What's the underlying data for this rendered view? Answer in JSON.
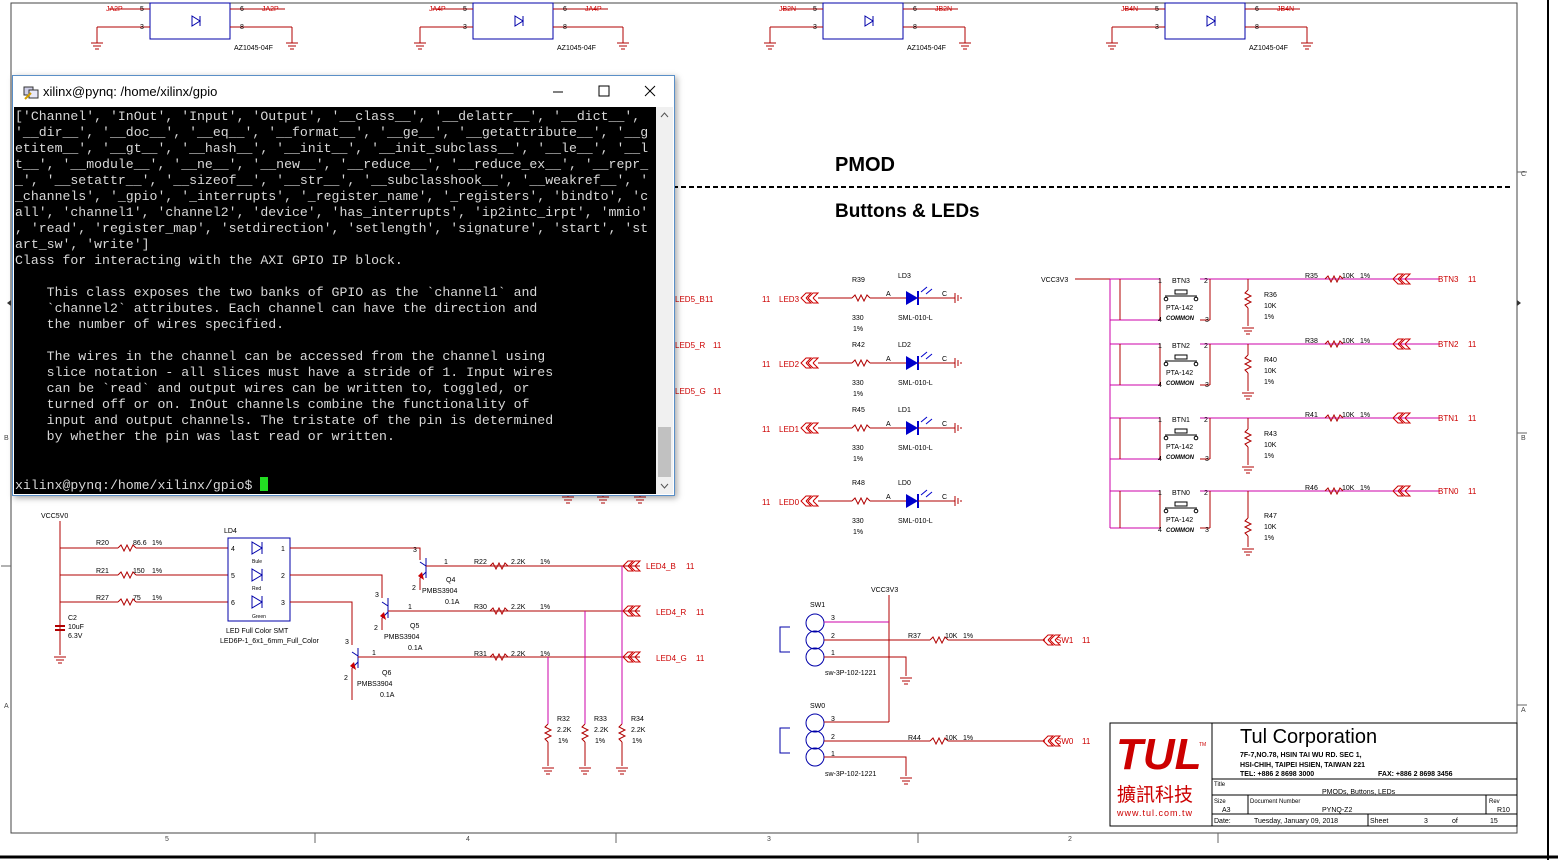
{
  "terminal": {
    "title": "xilinx@pynq: /home/xilinx/gpio",
    "lines": [
      "['Channel', 'InOut', 'Input', 'Output', '__class__', '__delattr__', '__dict__',",
      "'__dir__', '__doc__', '__eq__', '__format__', '__ge__', '__getattribute__', '__g",
      "etitem__', '__gt__', '__hash__', '__init__', '__init_subclass__', '__le__', '__l",
      "t__', '__module__', '__ne__', '__new__', '__reduce__', '__reduce_ex__', '__repr_",
      "_', '__setattr__', '__sizeof__', '__str__', '__subclasshook__', '__weakref__', '",
      "_channels', '_gpio', '_interrupts', '_register_name', '_registers', 'bindto', 'c",
      "all', 'channel1', 'channel2', 'device', 'has_interrupts', 'ip2intc_irpt', 'mmio'",
      ", 'read', 'register_map', 'setdirection', 'setlength', 'signature', 'start', 'st",
      "art_sw', 'write']",
      "Class for interacting with the AXI GPIO IP block.",
      "",
      "    This class exposes the two banks of GPIO as the `channel1` and",
      "    `channel2` attributes. Each channel can have the direction and",
      "    the number of wires specified.",
      "",
      "    The wires in the channel can be accessed from the channel using",
      "    slice notation - all slices must have a stride of 1. Input wires",
      "    can be `read` and output wires can be written to, toggled, or",
      "    turned off or on. InOut channels combine the functionality of",
      "    input and output channels. The tristate of the pin is determined",
      "    by whether the pin was last read or written.",
      "",
      ""
    ],
    "prompt": "xilinx@pynq:/home/xilinx/gpio$ "
  },
  "schematic": {
    "section_pmod": "PMOD",
    "section_buttons": "Buttons & LEDs",
    "top_parts": [
      {
        "net_left": "JA2P",
        "net_right": "JA2P",
        "part": "AZ1045-04F"
      },
      {
        "net_left": "JA4P",
        "net_right": "JA4P",
        "part": "AZ1045-04F"
      },
      {
        "net_left": "JB2N",
        "net_right": "JB2N",
        "part": "AZ1045-04F"
      },
      {
        "net_left": "JB4N",
        "net_right": "JB4N",
        "part": "AZ1045-04F"
      }
    ],
    "pin_labels": {
      "p5": "5",
      "p6": "6",
      "p3": "3",
      "p8": "8"
    },
    "led5_nets": [
      {
        "net": "LED5_B",
        "sheet": "11"
      },
      {
        "net": "LED5_R",
        "sheet": "11"
      },
      {
        "net": "LED5_G",
        "sheet": "11"
      }
    ],
    "leds": [
      {
        "sheet": "11",
        "net": "LED3",
        "res": "R39",
        "val": "330",
        "tol": "1%",
        "ref": "LD3",
        "part": "SML-010-L"
      },
      {
        "sheet": "11",
        "net": "LED2",
        "res": "R42",
        "val": "330",
        "tol": "1%",
        "ref": "LD2",
        "part": "SML-010-L"
      },
      {
        "sheet": "11",
        "net": "LED1",
        "res": "R45",
        "val": "330",
        "tol": "1%",
        "ref": "LD1",
        "part": "SML-010-L"
      },
      {
        "sheet": "11",
        "net": "LED0",
        "res": "R48",
        "val": "330",
        "tol": "1%",
        "ref": "LD0",
        "part": "SML-010-L"
      }
    ],
    "anode": "A",
    "cathode": "C",
    "vcc3v3": "VCC3V3",
    "buttons": [
      {
        "ref": "BTN3",
        "part": "PTA-142",
        "common": "COMMON",
        "res": "R36",
        "rval": "10K",
        "rtol": "1%",
        "sres": "R35",
        "sval": "10K",
        "stol": "1%",
        "net": "BTN3",
        "sheet": "11"
      },
      {
        "ref": "BTN2",
        "part": "PTA-142",
        "common": "COMMON",
        "res": "R40",
        "rval": "10K",
        "rtol": "1%",
        "sres": "R38",
        "sval": "10K",
        "stol": "1%",
        "net": "BTN2",
        "sheet": "11"
      },
      {
        "ref": "BTN1",
        "part": "PTA-142",
        "common": "COMMON",
        "res": "R43",
        "rval": "10K",
        "rtol": "1%",
        "sres": "R41",
        "sval": "10K",
        "stol": "1%",
        "net": "BTN1",
        "sheet": "11"
      },
      {
        "ref": "BTN0",
        "part": "PTA-142",
        "common": "COMMON",
        "res": "R47",
        "rval": "10K",
        "rtol": "1%",
        "sres": "R46",
        "sval": "10K",
        "stol": "1%",
        "net": "BTN0",
        "sheet": "11"
      }
    ],
    "btn_pins": {
      "p1": "1",
      "p2": "2",
      "p3": "3",
      "p4": "4"
    },
    "rgb": {
      "vcc": "VCC5V0",
      "ld4": "LD4",
      "ld4_desc": "LED Full Color SMT",
      "ld4_part": "LED6P-1_6x1_6mm_Full_Color",
      "color_blue": "Bule",
      "color_red": "Red",
      "color_green": "Green",
      "r20": "R20",
      "r20v": "86.6",
      "r20t": "1%",
      "r21": "R21",
      "r21v": "150",
      "r21t": "1%",
      "r27": "R27",
      "r27v": "75",
      "r27t": "1%",
      "c2": "C2",
      "c2v": "10uF",
      "c2r": "6.3V",
      "q4": "Q4",
      "q5": "Q5",
      "q6": "Q6",
      "qpart": "PMBS3904",
      "qcur": "0.1A",
      "r22": "R22",
      "r30": "R30",
      "r31": "R31",
      "rv22": "2.2K",
      "rt": "1%",
      "r32": "R32",
      "r33": "R33",
      "r34": "R34",
      "led4": [
        {
          "net": "LED4_B",
          "sheet": "11"
        },
        {
          "net": "LED4_R",
          "sheet": "11"
        },
        {
          "net": "LED4_G",
          "sheet": "11"
        }
      ],
      "pins": {
        "p1": "1",
        "p2": "2",
        "p3": "3",
        "p4": "4",
        "p5": "5",
        "p6": "6"
      }
    },
    "switches": [
      {
        "ref": "SW1",
        "part": "sw-3P-102-1221",
        "res": "R37",
        "val": "10K",
        "tol": "1%",
        "net": "SW1",
        "sheet": "11"
      },
      {
        "ref": "SW0",
        "part": "sw-3P-102-1221",
        "res": "R44",
        "val": "10K",
        "tol": "1%",
        "net": "SW0",
        "sheet": "11"
      }
    ],
    "titleblock": {
      "logo": "TUL",
      "logo_tm": "TM",
      "chinese": "擴訊科技",
      "url": "www.tul.com.tw",
      "company": "Tul Corporation",
      "addr1": "7F-7,NO.78, HSIN TAI WU RD. SEC 1,",
      "addr2": "HSI-CHIH, TAIPEI HSIEN, TAIWAN 221",
      "tel": "TEL: +886 2 8698 3000",
      "fax": "FAX: +886 2 8698 3456",
      "title_label": "Title",
      "title": "PMODs, Buttons, LEDs",
      "size_label": "Size",
      "size": "A3",
      "docnum_label": "Document Number",
      "docnum": "PYNQ-Z2",
      "rev_label": "Rev",
      "rev": "R10",
      "date_label": "Date:",
      "date": "Tuesday, January 09, 2018",
      "sheet_label": "Sheet",
      "sheet": "3",
      "of_label": "of",
      "total": "15"
    },
    "frame": {
      "bottom": [
        "5",
        "4",
        "3",
        "2"
      ],
      "side_c": "C",
      "side_b": "B",
      "side_a": "A"
    }
  }
}
